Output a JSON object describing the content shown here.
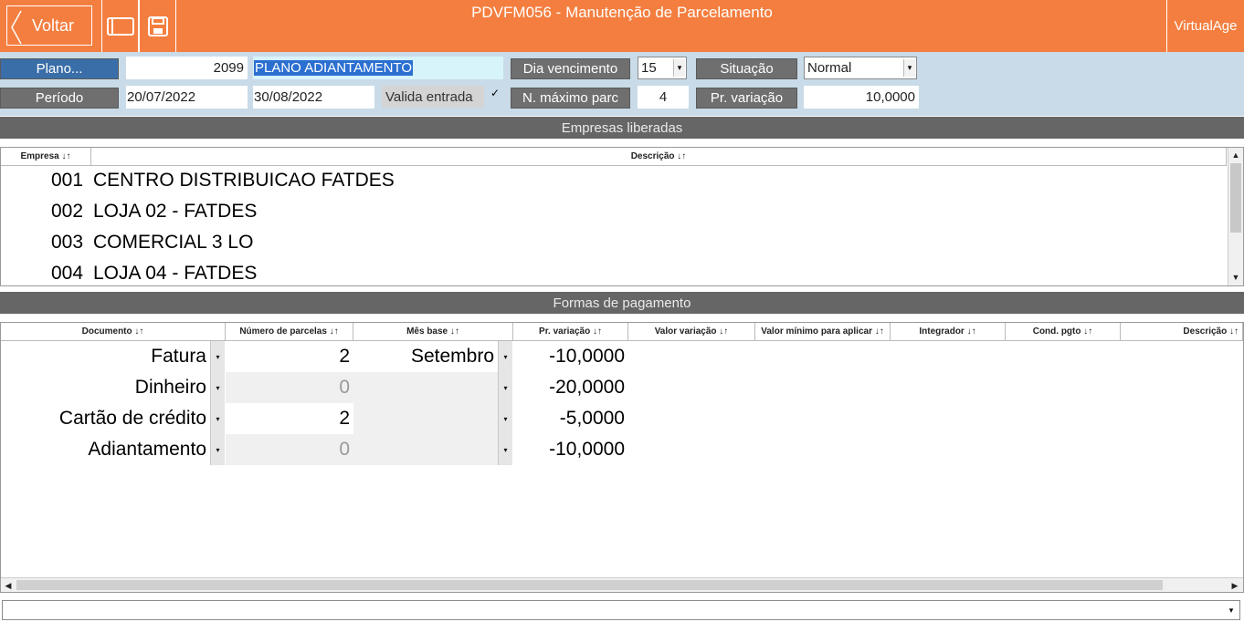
{
  "header": {
    "back_label": "Voltar",
    "title": "PDVFM056 - Manutenção de Parcelamento",
    "brand": "VirtualAge"
  },
  "form": {
    "plano_label": "Plano...",
    "plano_code": "2099",
    "plano_name": "PLANO ADIANTAMENTO",
    "dia_vencimento_label": "Dia vencimento",
    "dia_vencimento_value": "15",
    "situacao_label": "Situação",
    "situacao_value": "Normal",
    "periodo_label": "Período",
    "periodo_start": "20/07/2022",
    "periodo_end": "30/08/2022",
    "valida_entrada_label": "Valida entrada",
    "valida_entrada_checked": "✓",
    "n_maximo_label": "N. máximo parc",
    "n_maximo_value": "4",
    "pr_variacao_label": "Pr. variação",
    "pr_variacao_value": "10,0000"
  },
  "empresas": {
    "section_title": "Empresas liberadas",
    "columns": [
      "Empresa ↓↑",
      "Descrição ↓↑"
    ],
    "rows": [
      {
        "code": "001",
        "name": "CENTRO DISTRIBUICAO FATDES"
      },
      {
        "code": "002",
        "name": "LOJA 02 - FATDES"
      },
      {
        "code": "003",
        "name": "COMERCIAL 3 LO"
      },
      {
        "code": "004",
        "name": "LOJA 04 - FATDES"
      }
    ]
  },
  "formas": {
    "section_title": "Formas de pagamento",
    "columns": [
      "Documento ↓↑",
      "Número de parcelas ↓↑",
      "Mês base ↓↑",
      "Pr. variação ↓↑",
      "Valor variação ↓↑",
      "Valor mínimo para aplicar ↓↑",
      "Integrador ↓↑",
      "Cond. pgto ↓↑",
      "Descrição ↓↑"
    ],
    "rows": [
      {
        "documento": "Fatura",
        "parcelas": "2",
        "mes_base": "Setembro",
        "pr_variacao": "-10,0000"
      },
      {
        "documento": "Dinheiro",
        "parcelas": "0",
        "mes_base": "",
        "pr_variacao": "-20,0000"
      },
      {
        "documento": "Cartão de crédito",
        "parcelas": "2",
        "mes_base": "",
        "pr_variacao": "-5,0000"
      },
      {
        "documento": "Adiantamento",
        "parcelas": "0",
        "mes_base": "",
        "pr_variacao": "-10,0000"
      }
    ]
  },
  "icons": {
    "back": "chevron-left-icon",
    "window": "window-icon",
    "save": "floppy-disk-icon",
    "dropdown": "▾",
    "scroll_up": "▲",
    "scroll_down": "▼",
    "scroll_left": "◀",
    "scroll_right": "▶"
  },
  "colors": {
    "header": "#f47e3f",
    "form_bg": "#c9dbe8",
    "section_bar": "#666666",
    "selection": "#2b6fd1"
  }
}
